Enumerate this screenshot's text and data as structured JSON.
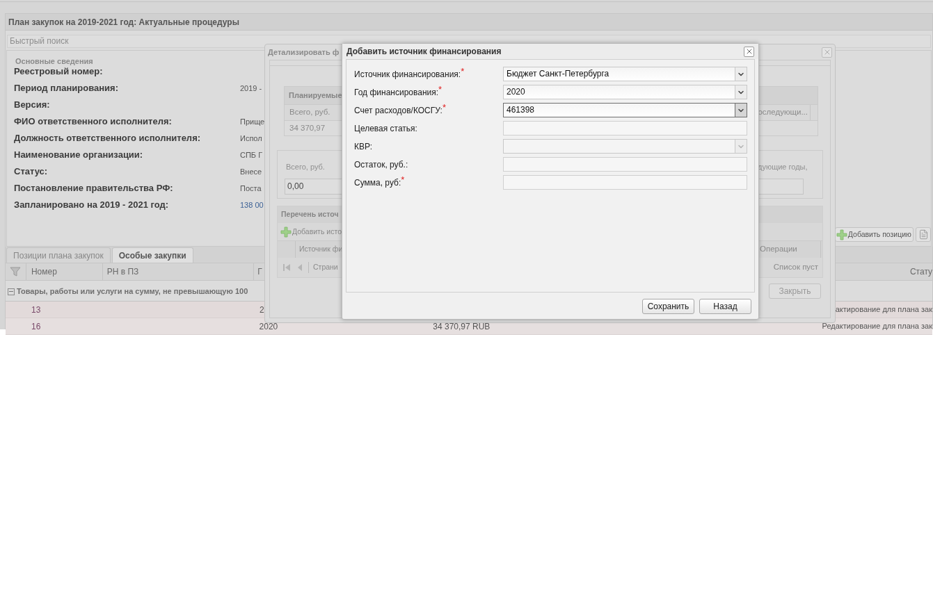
{
  "main_window": {
    "title": "План закупок на 2019-2021 год: Актуальные процедуры",
    "search": {
      "placeholder": "Быстрый поиск"
    },
    "details": {
      "title": "Основные сведения",
      "fields": [
        {
          "label": "Реестровый номер:",
          "kind": "text"
        },
        {
          "label": "Период планирования:",
          "value": "2019 -",
          "kind": "text"
        },
        {
          "label": "Версия:",
          "kind": "text"
        },
        {
          "label": "ФИО ответственного исполнителя:",
          "value": "Прище",
          "kind": "text"
        },
        {
          "label": "Должность ответственного исполнителя:",
          "value": "Испол",
          "kind": "text"
        },
        {
          "label": "Наименование организации:",
          "value": "СПБ Г",
          "kind": "text"
        },
        {
          "label": "Статус:",
          "value": "Внесе",
          "kind": "text"
        },
        {
          "label": "Постановление правительства РФ:",
          "value": "Поста",
          "kind": "text"
        },
        {
          "label": "Запланировано на 2019 - 2021 год:",
          "value": "138 00",
          "kind": "amount"
        }
      ]
    },
    "toolbar": [
      {
        "kind": "add",
        "label": "Добавить позицию"
      },
      {
        "kind": "document"
      }
    ],
    "tabs": [
      {
        "label": "Позиции плана закупок",
        "selected": false
      },
      {
        "label": "Особые закупки",
        "selected": true
      }
    ],
    "grid": {
      "columns": [
        "Номер",
        "РН в ПЗ",
        "Г",
        "Стату"
      ],
      "group": {
        "label": "Товары, работы или услуги на сумму, не превышающую 100",
        "expanded": true
      },
      "rows": [
        {
          "number": "13",
          "column_3": "2",
          "status": "актирование для плана зак"
        },
        {
          "number": "16",
          "column_3": "2020",
          "column_4": "34 370,97 RUB",
          "status": "Редактирование для плана зак"
        }
      ]
    }
  },
  "detail_dialog": {
    "title": "Детализировать ф",
    "planned": {
      "title": "Планируемые",
      "columns": [
        "Всего, руб.",
        "оследующи..."
      ],
      "rows": [
        [
          "34 370,97"
        ]
      ]
    },
    "totals": [
      {
        "label": "Всего, руб.",
        "value": "0,00"
      },
      {
        "label": "дующие годы,"
      }
    ],
    "sources": {
      "title": "Перечень источ",
      "add_button": "Добавить исто",
      "columns": [
        "Источник фи",
        "Операции"
      ],
      "paging_label": "Страни",
      "empty_text": "Список пуст"
    },
    "buttons": [
      "Закрыть"
    ]
  },
  "add_dialog": {
    "title": "Добавить источник финансирования",
    "fields": [
      {
        "kind": "combo",
        "label": "Источник финансирования:",
        "required_mark": "*",
        "value": "Бюджет Санкт-Петербурга",
        "focused": false,
        "disabled": false
      },
      {
        "kind": "combo",
        "label": "Год финансирования:",
        "required_mark": "*",
        "value": "2020",
        "focused": false,
        "disabled": false
      },
      {
        "kind": "combo",
        "label": "Счет расходов/КОСГУ:",
        "required_mark": "*",
        "value": "461398",
        "focused": true,
        "disabled": false
      },
      {
        "kind": "text",
        "label": "Целевая статья:",
        "focused": false,
        "disabled": false
      },
      {
        "kind": "combo",
        "label": "КВР:",
        "focused": false,
        "disabled": true
      },
      {
        "kind": "text",
        "label": "Остаток, руб.:",
        "focused": false,
        "disabled": false
      },
      {
        "kind": "text",
        "label": "Сумма, руб:",
        "required_mark": "*",
        "focused": false,
        "disabled": false
      }
    ],
    "buttons": [
      "Сохранить",
      "Назад"
    ]
  }
}
